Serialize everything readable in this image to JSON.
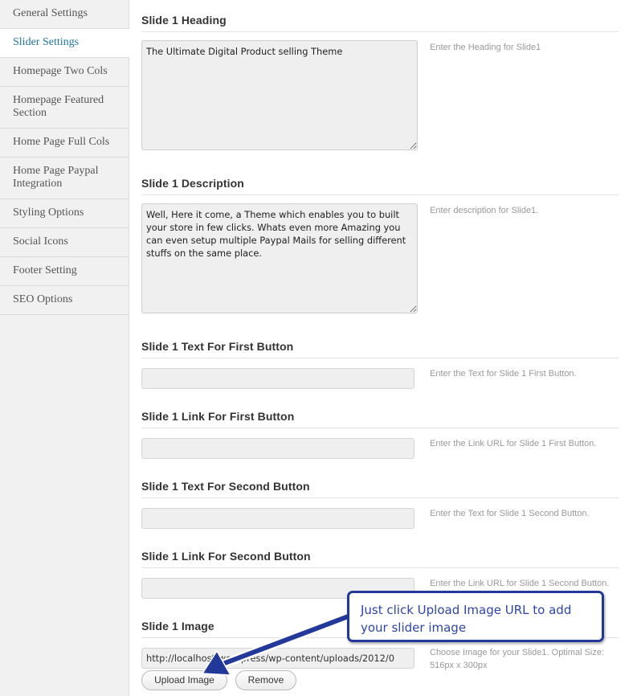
{
  "sidebar": {
    "items": [
      {
        "label": "General Settings",
        "active": false
      },
      {
        "label": "Slider Settings",
        "active": true
      },
      {
        "label": "Homepage Two Cols",
        "active": false
      },
      {
        "label": "Homepage Featured Section",
        "active": false
      },
      {
        "label": "Home Page Full Cols",
        "active": false
      },
      {
        "label": "Home Page Paypal Integration",
        "active": false
      },
      {
        "label": "Styling Options",
        "active": false
      },
      {
        "label": "Social Icons",
        "active": false
      },
      {
        "label": "Footer Setting",
        "active": false
      },
      {
        "label": "SEO Options",
        "active": false
      }
    ]
  },
  "fields": {
    "heading": {
      "label": "Slide 1 Heading",
      "value": "The Ultimate Digital Product selling Theme",
      "hint": "Enter the Heading for Slide1"
    },
    "description": {
      "label": "Slide 1 Description",
      "value": "Well, Here it come, a Theme which enables you to built your store in few clicks. Whats even more Amazing you can even setup multiple Paypal Mails for selling different stuffs on the same place.",
      "hint": "Enter description for Slide1."
    },
    "first_text": {
      "label": "Slide 1 Text For First Button",
      "value": "",
      "hint": "Enter the Text for Slide 1 First Button."
    },
    "first_link": {
      "label": "Slide 1 Link For First Button",
      "value": "",
      "hint": "Enter the Link URL for Slide 1 First Button."
    },
    "second_text": {
      "label": "Slide 1 Text For Second Button",
      "value": "",
      "hint": "Enter the Text for Slide 1 Second Button."
    },
    "second_link": {
      "label": "Slide 1 Link For Second Button",
      "value": "",
      "hint": "Enter the Link URL for Slide 1 Second Button."
    },
    "image": {
      "label": "Slide 1 Image",
      "value": "http://localhost/wordpress/wp-content/uploads/2012/0",
      "hint": "Choose Image for your Slide1. Optimal Size: 516px x 300px"
    }
  },
  "buttons": {
    "upload": "Upload Image",
    "remove": "Remove"
  },
  "callout": {
    "text": "Just click Upload Image URL to add your slider image"
  },
  "colors": {
    "active_nav": "#21759b",
    "callout": "#23399a"
  }
}
